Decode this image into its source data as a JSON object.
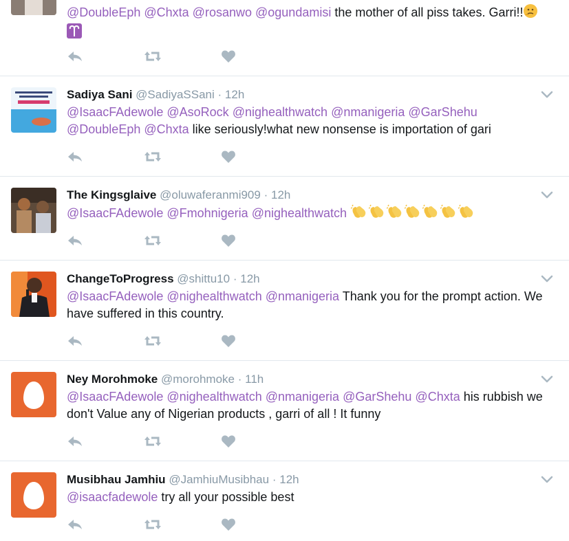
{
  "tweets": [
    {
      "name": "",
      "handle": "",
      "time": "",
      "text": [
        {
          "t": "@DoubleEph",
          "mention": true
        },
        {
          "t": " "
        },
        {
          "t": "@Chxta",
          "mention": true
        },
        {
          "t": " "
        },
        {
          "t": "@rosanwo",
          "mention": true
        },
        {
          "t": " "
        },
        {
          "t": "@ogundamisi",
          "mention": true
        },
        {
          "t": " the mother of all piss takes. Garri!!"
        }
      ],
      "emojis": [
        "thinking-face-emoji",
        "aries-sign-emoji"
      ]
    },
    {
      "name": "Sadiya Sani",
      "handle": "@SadiyaSSani",
      "time": "12h",
      "text": [
        {
          "t": "@IsaacFAdewole",
          "mention": true
        },
        {
          "t": " "
        },
        {
          "t": "@AsoRock",
          "mention": true
        },
        {
          "t": " "
        },
        {
          "t": "@nighealthwatch",
          "mention": true
        },
        {
          "t": " "
        },
        {
          "t": "@nmanigeria",
          "mention": true
        },
        {
          "t": " "
        },
        {
          "t": "@GarShehu",
          "mention": true
        },
        {
          "t": " "
        },
        {
          "t": "@DoubleEph",
          "mention": true
        },
        {
          "t": " "
        },
        {
          "t": "@Chxta",
          "mention": true
        },
        {
          "t": " like seriously!what new nonsense is importation of gari"
        }
      ]
    },
    {
      "name": "The Kingsglaive",
      "handle": "@oluwaferanmi909",
      "time": "12h",
      "text": [
        {
          "t": "@IsaacFAdewole",
          "mention": true
        },
        {
          "t": " "
        },
        {
          "t": "@Fmohnigeria",
          "mention": true
        },
        {
          "t": " "
        },
        {
          "t": "@nighealthwatch",
          "mention": true
        },
        {
          "t": " "
        }
      ],
      "emojis": [
        "clapping-hands-emoji",
        "clapping-hands-emoji",
        "clapping-hands-emoji",
        "clapping-hands-emoji",
        "clapping-hands-emoji",
        "clapping-hands-emoji",
        "clapping-hands-emoji"
      ]
    },
    {
      "name": "ChangeToProgress",
      "handle": "@shittu10",
      "time": "12h",
      "text": [
        {
          "t": "@IsaacFAdewole",
          "mention": true
        },
        {
          "t": " "
        },
        {
          "t": "@nighealthwatch",
          "mention": true
        },
        {
          "t": " "
        },
        {
          "t": "@nmanigeria",
          "mention": true
        },
        {
          "t": "  Thank you for the prompt action. We have suffered in this country."
        }
      ]
    },
    {
      "name": "Ney Morohmoke",
      "handle": "@morohmoke",
      "time": "11h",
      "text": [
        {
          "t": "@IsaacFAdewole",
          "mention": true
        },
        {
          "t": "  "
        },
        {
          "t": "@nighealthwatch",
          "mention": true
        },
        {
          "t": " "
        },
        {
          "t": "@nmanigeria",
          "mention": true
        },
        {
          "t": " "
        },
        {
          "t": "@GarShehu",
          "mention": true
        },
        {
          "t": " "
        },
        {
          "t": "@Chxta",
          "mention": true
        },
        {
          "t": " his rubbish we don't Value any of Nigerian products , garri of all ! It funny"
        }
      ]
    },
    {
      "name": "Musibhau Jamhiu",
      "handle": "@JamhiuMusibhau",
      "time": "12h",
      "text": [
        {
          "t": "@isaacfadewole",
          "mention": true
        },
        {
          "t": " try all your possible best"
        }
      ]
    }
  ],
  "separator": "·",
  "icons": {
    "reply": "reply-icon",
    "retweet": "retweet-icon",
    "like": "heart-icon",
    "more": "chevron-down-icon",
    "default_avatar": "egg-avatar-icon"
  },
  "colors": {
    "mention": "#9560bd",
    "muted": "#8899a6",
    "icon": "#aab8c2",
    "egg_bg": "#e8672f"
  }
}
